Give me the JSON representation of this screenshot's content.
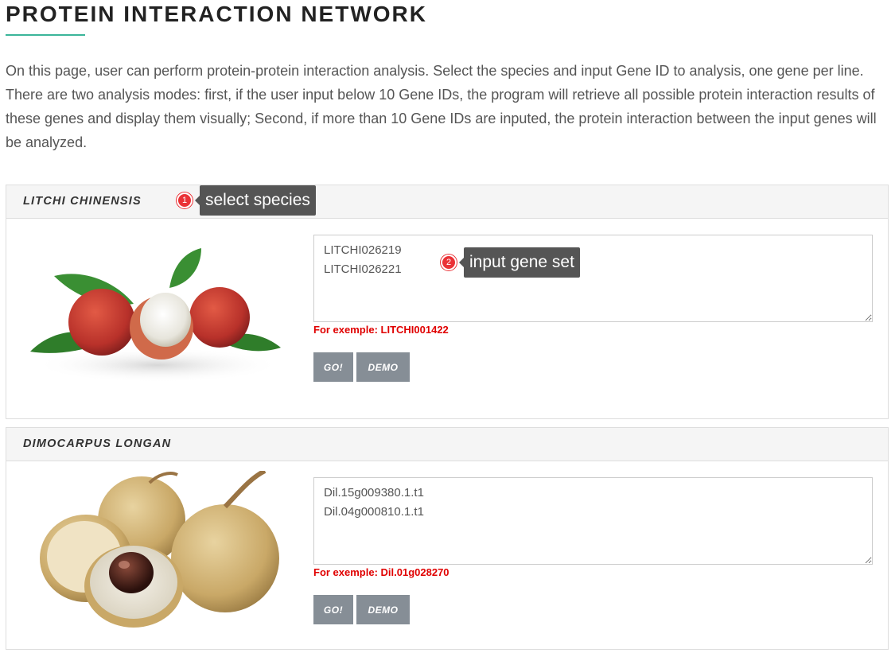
{
  "header": {
    "title": "PROTEIN INTERACTION NETWORK",
    "intro": "On this page, user can perform protein-protein interaction analysis. Select the species and input Gene ID to analysis, one gene per line. There are two analysis modes: first, if the user input below 10 Gene IDs, the program will retrieve all possible protein interaction results of these genes and display them visually; Second, if more than 10 Gene IDs are inputed, the protein interaction between the input genes will be analyzed."
  },
  "panels": [
    {
      "species": "LITCHI CHINENSIS",
      "textarea_value": "LITCHI026219\nLITCHI026221",
      "example": "For exemple: LITCHI001422",
      "go_label": "GO!",
      "demo_label": "DEMO"
    },
    {
      "species": "DIMOCARPUS LONGAN",
      "textarea_value": "Dil.15g009380.1.t1\nDil.04g000810.1.t1",
      "example": "For exemple: Dil.01g028270",
      "go_label": "GO!",
      "demo_label": "DEMO"
    }
  ],
  "annotations": [
    {
      "number": "1",
      "text": "select species"
    },
    {
      "number": "2",
      "text": "input gene set"
    }
  ],
  "colors": {
    "accent": "#3bb59a",
    "button": "#868e96",
    "example_text": "#e00000",
    "badge": "#ea3136",
    "tooltip": "#555555"
  }
}
